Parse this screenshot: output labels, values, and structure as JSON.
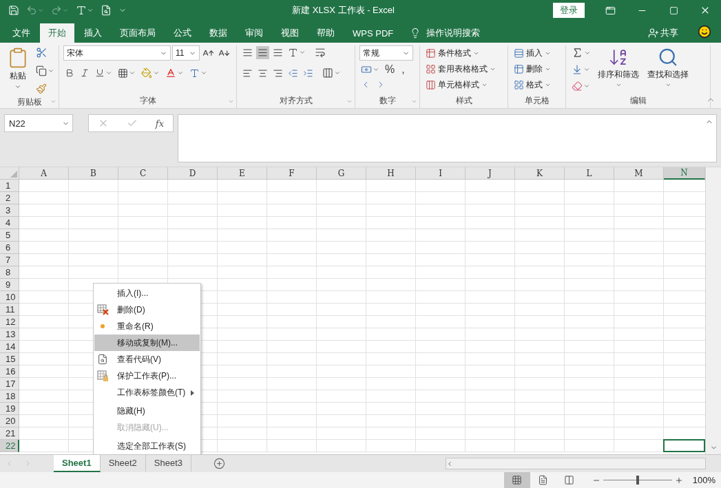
{
  "title_bar": {
    "title": "新建 XLSX 工作表  -  Excel",
    "login": "登录"
  },
  "ribbon_tabs": [
    {
      "label": "文件",
      "selected": false
    },
    {
      "label": "开始",
      "selected": true
    },
    {
      "label": "插入",
      "selected": false
    },
    {
      "label": "页面布局",
      "selected": false
    },
    {
      "label": "公式",
      "selected": false
    },
    {
      "label": "数据",
      "selected": false
    },
    {
      "label": "审阅",
      "selected": false
    },
    {
      "label": "视图",
      "selected": false
    },
    {
      "label": "帮助",
      "selected": false
    },
    {
      "label": "WPS PDF",
      "selected": false
    }
  ],
  "tell_me": "操作说明搜索",
  "share": "共享",
  "ribbon": {
    "clipboard": {
      "paste": "粘贴",
      "label": "剪贴板"
    },
    "font": {
      "name": "宋体",
      "size": "11",
      "label": "字体"
    },
    "alignment": {
      "label": "对齐方式"
    },
    "number": {
      "format": "常规",
      "percent": "%",
      "comma": ",",
      "label": "数字"
    },
    "styles": {
      "items": [
        "条件格式",
        "套用表格格式",
        "单元格样式"
      ],
      "label": "样式"
    },
    "cells": {
      "items": [
        "插入",
        "删除",
        "格式"
      ],
      "label": "单元格"
    },
    "editing": {
      "items": [
        "排序和筛选",
        "查找和选择"
      ],
      "label": "编辑"
    }
  },
  "formula_bar": {
    "name_box": "N22",
    "fx": "fx"
  },
  "grid": {
    "columns": [
      {
        "label": "A",
        "selected": false
      },
      {
        "label": "B",
        "selected": false
      },
      {
        "label": "C",
        "selected": false
      },
      {
        "label": "D",
        "selected": false
      },
      {
        "label": "E",
        "selected": false
      },
      {
        "label": "F",
        "selected": false
      },
      {
        "label": "G",
        "selected": false
      },
      {
        "label": "H",
        "selected": false
      },
      {
        "label": "I",
        "selected": false
      },
      {
        "label": "J",
        "selected": false
      },
      {
        "label": "K",
        "selected": false
      },
      {
        "label": "L",
        "selected": false
      },
      {
        "label": "M",
        "selected": false
      },
      {
        "label": "N",
        "selected": true
      }
    ],
    "rows": [
      {
        "label": "1",
        "selected": false
      },
      {
        "label": "2",
        "selected": false
      },
      {
        "label": "3",
        "selected": false
      },
      {
        "label": "4",
        "selected": false
      },
      {
        "label": "5",
        "selected": false
      },
      {
        "label": "6",
        "selected": false
      },
      {
        "label": "7",
        "selected": false
      },
      {
        "label": "8",
        "selected": false
      },
      {
        "label": "9",
        "selected": false
      },
      {
        "label": "10",
        "selected": false
      },
      {
        "label": "11",
        "selected": false
      },
      {
        "label": "12",
        "selected": false
      },
      {
        "label": "13",
        "selected": false
      },
      {
        "label": "14",
        "selected": false
      },
      {
        "label": "15",
        "selected": false
      },
      {
        "label": "16",
        "selected": false
      },
      {
        "label": "17",
        "selected": false
      },
      {
        "label": "18",
        "selected": false
      },
      {
        "label": "19",
        "selected": false
      },
      {
        "label": "20",
        "selected": false
      },
      {
        "label": "21",
        "selected": false
      },
      {
        "label": "22",
        "selected": true
      }
    ]
  },
  "context_menu": {
    "items": [
      {
        "label": "插入(I)...",
        "kind": "plain",
        "selected": false,
        "disabled": false,
        "separator_before": false
      },
      {
        "label": "删除(D)",
        "kind": "delete",
        "selected": false,
        "disabled": false,
        "separator_before": false
      },
      {
        "label": "重命名(R)",
        "kind": "rename",
        "selected": false,
        "disabled": false,
        "separator_before": false
      },
      {
        "label": "移动或复制(M)...",
        "kind": "plain",
        "selected": true,
        "disabled": false,
        "separator_before": false
      },
      {
        "label": "查看代码(V)",
        "kind": "code",
        "selected": false,
        "disabled": false,
        "separator_before": false
      },
      {
        "label": "保护工作表(P)...",
        "kind": "protect",
        "selected": false,
        "disabled": false,
        "separator_before": false
      },
      {
        "label": "工作表标签颜色(T)",
        "kind": "submenu",
        "selected": false,
        "disabled": false,
        "separator_before": false
      },
      {
        "label": "隐藏(H)",
        "kind": "plain",
        "selected": false,
        "disabled": false,
        "separator_before": true
      },
      {
        "label": "取消隐藏(U)...",
        "kind": "plain",
        "selected": false,
        "disabled": true,
        "separator_before": false
      },
      {
        "label": "选定全部工作表(S)",
        "kind": "plain",
        "selected": false,
        "disabled": false,
        "separator_before": true
      }
    ]
  },
  "sheet_tabs": [
    {
      "label": "Sheet1",
      "selected": true
    },
    {
      "label": "Sheet2",
      "selected": false
    },
    {
      "label": "Sheet3",
      "selected": false
    }
  ],
  "status_bar": {
    "views": [
      {
        "kind": "normal",
        "selected": true
      },
      {
        "kind": "page_layout",
        "selected": false
      },
      {
        "kind": "page_break",
        "selected": false
      }
    ],
    "zoom": {
      "level": 0.5,
      "reading": "100%"
    }
  }
}
